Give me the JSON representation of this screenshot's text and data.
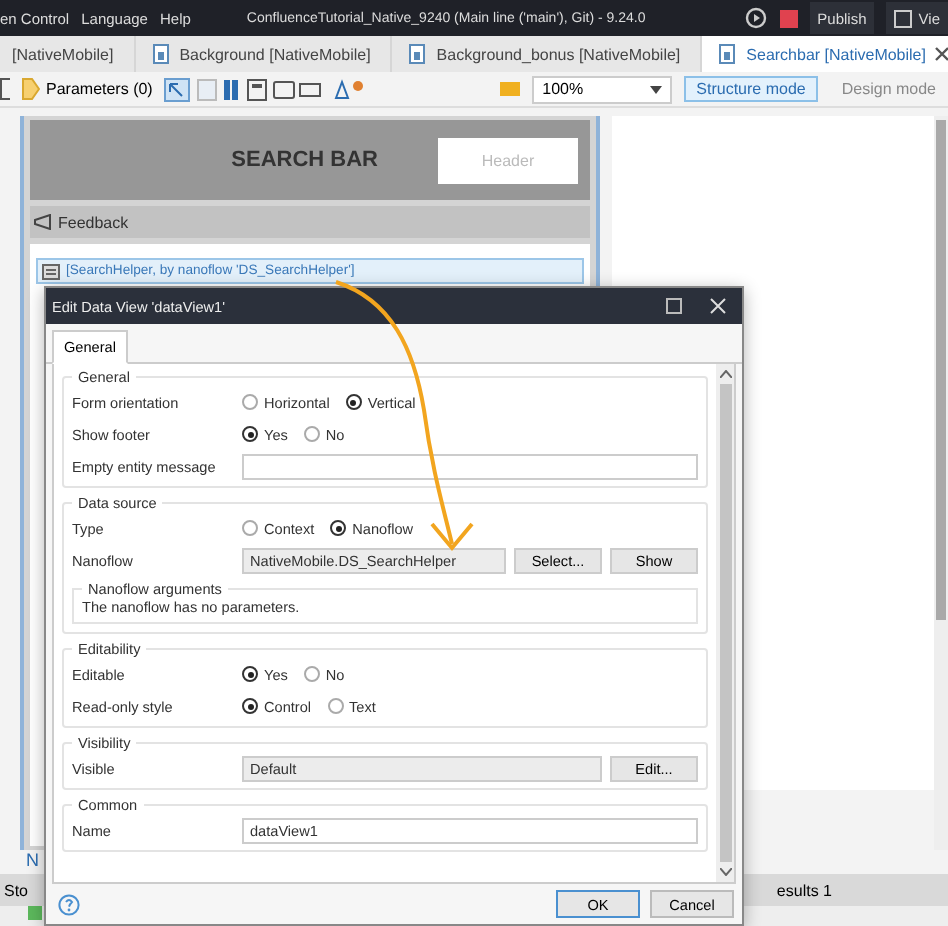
{
  "menu_bar": {
    "items": [
      "en Control",
      "Language",
      "Help"
    ],
    "title": "ConfluenceTutorial_Native_9240 (Main line ('main'), Git)  -  9.24.0",
    "actions": [
      "Publish",
      "Vie"
    ]
  },
  "tabs": [
    {
      "label": "[NativeMobile]",
      "selected": false,
      "icon": false
    },
    {
      "label": "Background [NativeMobile]",
      "selected": false,
      "icon": true
    },
    {
      "label": "Background_bonus [NativeMobile]",
      "selected": false,
      "icon": true
    },
    {
      "label": "Searchbar [NativeMobile]",
      "selected": true,
      "icon": true
    }
  ],
  "toolbar": {
    "parameters": "Parameters (0)",
    "zoom": "100%",
    "modes": [
      {
        "label": "Structure mode",
        "selected": true
      },
      {
        "label": "Design mode",
        "selected": false
      }
    ]
  },
  "canvas": {
    "header_title": "SEARCH BAR",
    "header_placeholder": "Header",
    "feedback": "Feedback",
    "data_view_label": "[SearchHelper, by nanoflow 'DS_SearchHelper']",
    "bottom_tab": "N"
  },
  "status_bar": {
    "left": "Sto",
    "right": "esults 1"
  },
  "dialog": {
    "title": "Edit Data View 'dataView1'",
    "tabs": [
      {
        "label": "General",
        "selected": true
      }
    ],
    "groups": [
      {
        "title": "General",
        "rows": [
          {
            "kind": "radio",
            "label": "Form orientation",
            "options": [
              {
                "label": "Horizontal",
                "selected": false
              },
              {
                "label": "Vertical",
                "selected": true
              }
            ]
          },
          {
            "kind": "radio",
            "label": "Show footer",
            "options": [
              {
                "label": "Yes",
                "selected": true
              },
              {
                "label": "No",
                "selected": false
              }
            ]
          },
          {
            "kind": "text",
            "label": "Empty entity message"
          }
        ]
      },
      {
        "title": "Data source",
        "rows": [
          {
            "kind": "radio",
            "label": "Type",
            "options": [
              {
                "label": "Context",
                "selected": false
              },
              {
                "label": "Nanoflow",
                "selected": true
              }
            ]
          },
          {
            "kind": "picker",
            "label": "Nanoflow",
            "value": "NativeMobile.DS_SearchHelper",
            "buttons": [
              "Select...",
              "Show"
            ]
          },
          {
            "kind": "subgroup",
            "label": "Nanoflow arguments",
            "text": "The nanoflow has no parameters."
          }
        ]
      },
      {
        "title": "Editability",
        "rows": [
          {
            "kind": "radio",
            "label": "Editable",
            "options": [
              {
                "label": "Yes",
                "selected": true
              },
              {
                "label": "No",
                "selected": false
              }
            ]
          },
          {
            "kind": "radio",
            "label": "Read-only style",
            "options": [
              {
                "label": "Control",
                "selected": true
              },
              {
                "label": "Text",
                "selected": false
              }
            ]
          }
        ]
      },
      {
        "title": "Visibility",
        "rows": [
          {
            "kind": "picker",
            "label": "Visible",
            "value": "Default",
            "buttons": [
              "Edit..."
            ]
          }
        ]
      },
      {
        "title": "Common",
        "rows": [
          {
            "kind": "text",
            "label": "Name",
            "value": "dataView1"
          }
        ]
      }
    ],
    "buttons": [
      "OK",
      "Cancel"
    ]
  }
}
